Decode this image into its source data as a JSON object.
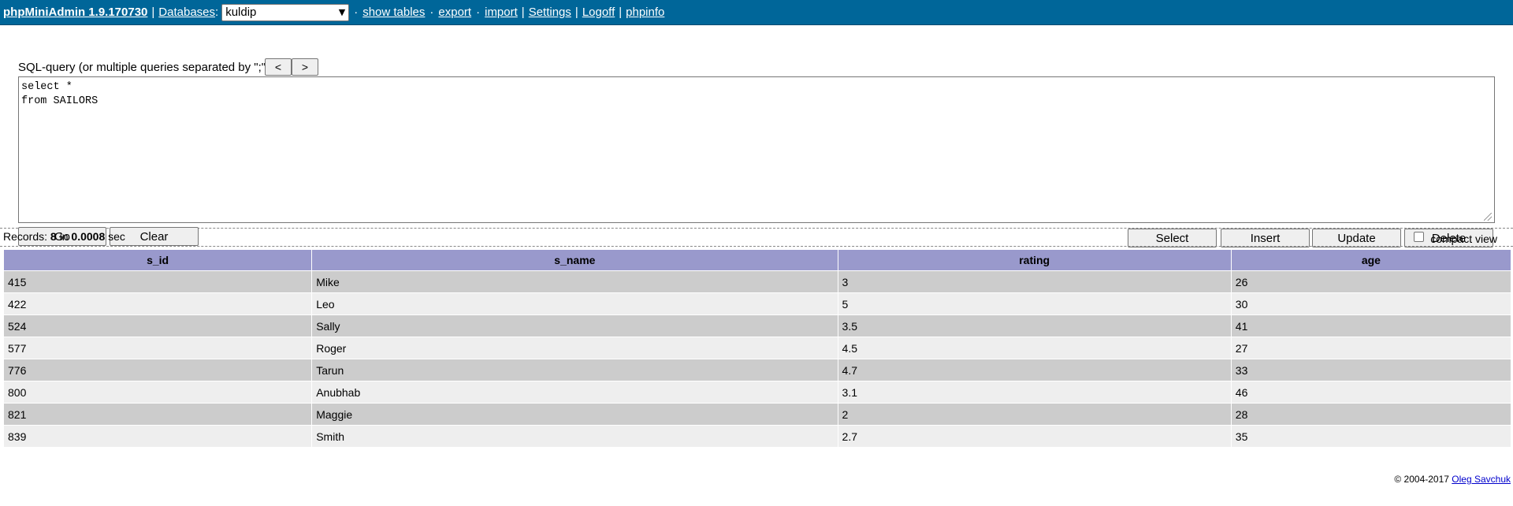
{
  "topbar": {
    "brand": "phpMiniAdmin 1.9.170730",
    "databases_label": "Databases",
    "db_selected": "kuldip",
    "links": [
      "show tables",
      "export",
      "import",
      "Settings",
      "Logoff",
      "phpinfo"
    ]
  },
  "query": {
    "label": "SQL-query (or multiple queries separated by \";\"):",
    "prev_label": "<",
    "next_label": ">",
    "sql_text": "select *\nfrom SAILORS",
    "go_label": "Go",
    "clear_label": "Clear",
    "select_label": "Select",
    "insert_label": "Insert",
    "update_label": "Update",
    "delete_label": "Delete"
  },
  "records": {
    "prefix": "Records: ",
    "count": "8",
    "middle": " in ",
    "time": "0.0008",
    "suffix": " sec",
    "compact_label": "compact view"
  },
  "table": {
    "columns": [
      "s_id",
      "s_name",
      "rating",
      "age"
    ],
    "rows": [
      [
        "415",
        "Mike",
        "3",
        "26"
      ],
      [
        "422",
        "Leo",
        "5",
        "30"
      ],
      [
        "524",
        "Sally",
        "3.5",
        "41"
      ],
      [
        "577",
        "Roger",
        "4.5",
        "27"
      ],
      [
        "776",
        "Tarun",
        "4.7",
        "33"
      ],
      [
        "800",
        "Anubhab",
        "3.1",
        "46"
      ],
      [
        "821",
        "Maggie",
        "2",
        "28"
      ],
      [
        "839",
        "Smith",
        "2.7",
        "35"
      ]
    ]
  },
  "footer": {
    "copyright": "© 2004-2017 ",
    "author": "Oleg Savchuk"
  }
}
